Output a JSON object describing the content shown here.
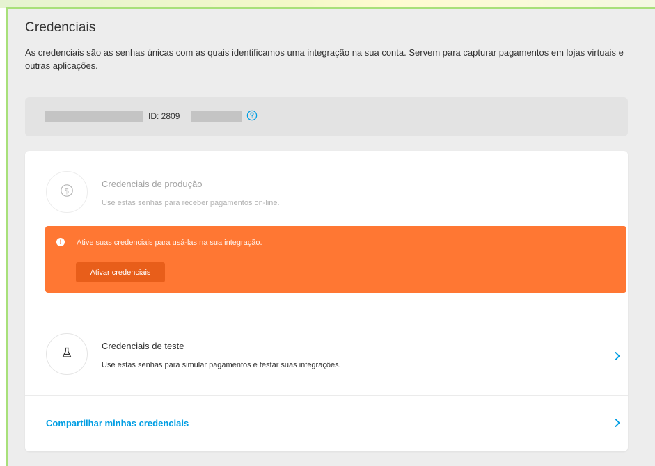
{
  "page": {
    "title": "Credenciais",
    "description": "As credenciais são as senhas únicas com as quais identificamos uma integração na sua conta. Servem para capturar pagamentos em lojas virtuais e outras aplicações."
  },
  "account": {
    "id_label": "ID: 2809",
    "help_icon": "question-circle-icon"
  },
  "production": {
    "icon": "dollar-circle-icon",
    "title": "Credenciais de produção",
    "subtitle": "Use estas senhas para receber pagamentos on-line.",
    "alert": {
      "icon": "exclamation-icon",
      "message": "Ative suas credenciais para usá-las na sua integração.",
      "button_label": "Ativar credenciais"
    }
  },
  "test": {
    "icon": "flask-icon",
    "title": "Credenciais de teste",
    "subtitle": "Use estas senhas para simular pagamentos e testar suas integrações."
  },
  "share": {
    "label": "Compartilhar minhas credenciais"
  },
  "colors": {
    "accent_blue": "#009ee3",
    "alert_orange": "#ff7733",
    "button_orange": "#e85e1a"
  }
}
